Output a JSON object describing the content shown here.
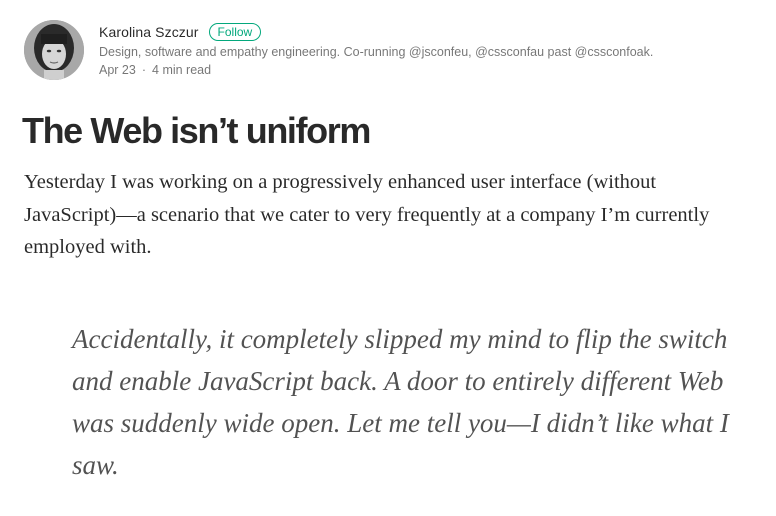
{
  "author": {
    "name": "Karolina Szczur",
    "follow_label": "Follow",
    "bio": "Design, software and empathy engineering. Co-running @jsconfeu, @cssconfau past @cssconfoak.",
    "date": "Apr 23",
    "separator": "·",
    "read_time": "4 min read"
  },
  "article": {
    "title": "The Web isn’t uniform",
    "paragraph": "Yesterday I was working on a progressively enhanced user interface (without JavaScript)—a scenario that we cater to very frequently at a company I’m currently employed with.",
    "pull_quote": "Accidentally, it completely slipped my mind to flip the switch and enable JavaScript back. A door to entirely different Web was suddenly wide open. Let me tell you—I didn’t like what I saw."
  },
  "colors": {
    "accent": "#03a87c",
    "text": "#2b2b2b",
    "muted": "#757575"
  },
  "icons": {
    "avatar": "author-avatar-photo"
  }
}
